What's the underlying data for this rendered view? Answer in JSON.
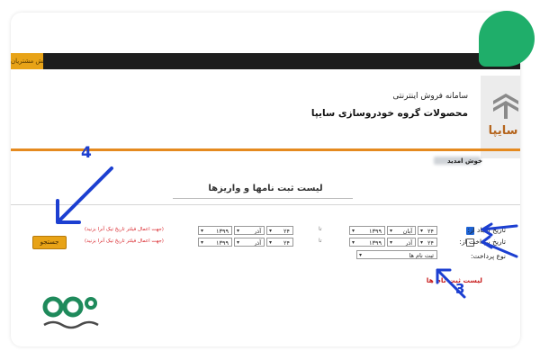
{
  "header": {
    "tab_label": "بخش مشتریان",
    "system_title": "سامانه فروش اینترنتی",
    "system_subtitle": "محصولات گروه خودروسازی سایپا",
    "logo_text": "سایپا"
  },
  "welcome": "خوش امدید",
  "list_title": "لیست ثبت نامها و واریزها",
  "filters": {
    "create_date_label": "تاریخ ایجاد از:",
    "payment_date_label": "تاریخ پرداخت از:",
    "payment_type_label": "نوع پرداخت:",
    "to_label": "تا",
    "create_from": {
      "day": "۲۴",
      "month": "آبان",
      "year": "۱۳۹۹"
    },
    "create_to": {
      "day": "۲۴",
      "month": "آذر",
      "year": "۱۳۹۹"
    },
    "pay_from": {
      "day": "۲۴",
      "month": "آذر",
      "year": "۱۳۹۹"
    },
    "pay_to": {
      "day": "۲۴",
      "month": "آذر",
      "year": "۱۳۹۹"
    },
    "payment_type_value": "ثبت نام ها",
    "hint": "(جهت اعمال فیلتر تاریخ تیک آنرا بزنید)"
  },
  "search_button": "جستجو",
  "registration_list": "لیست ثبت نام ها",
  "annotations": {
    "n3": "3",
    "n4": "4"
  },
  "colors": {
    "accent": "#e8a317",
    "arrow": "#1c3fd1",
    "orange_line": "#e58a1f",
    "hint": "#d9262c"
  },
  "icons": {
    "corner": "green-leaf-logo",
    "bottom": "brand-logo",
    "saipa": "saipa-logo"
  }
}
